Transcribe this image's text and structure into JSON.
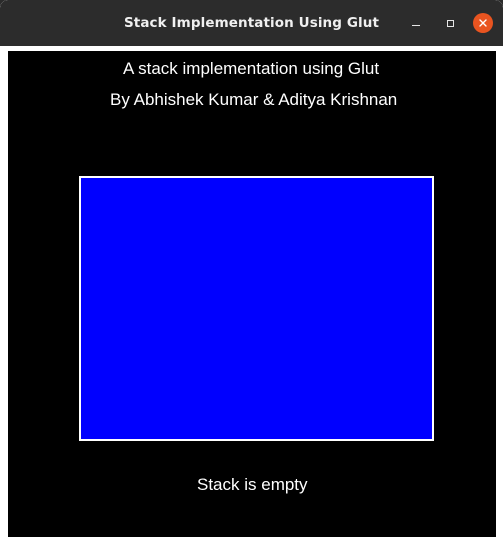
{
  "window": {
    "title": "Stack Implementation Using Glut",
    "controls": {
      "minimize_icon": "minimize-icon",
      "maximize_icon": "maximize-icon",
      "close_icon": "close-icon"
    }
  },
  "canvas": {
    "heading_line1": "A stack implementation using Glut",
    "heading_line2": "By Abhishek Kumar & Aditya Krishnan",
    "status": "Stack is empty",
    "colors": {
      "background": "#000000",
      "stack_fill": "#0000ff",
      "stack_border": "#ffffff",
      "text": "#ffffff",
      "close_button": "#e95420"
    }
  }
}
